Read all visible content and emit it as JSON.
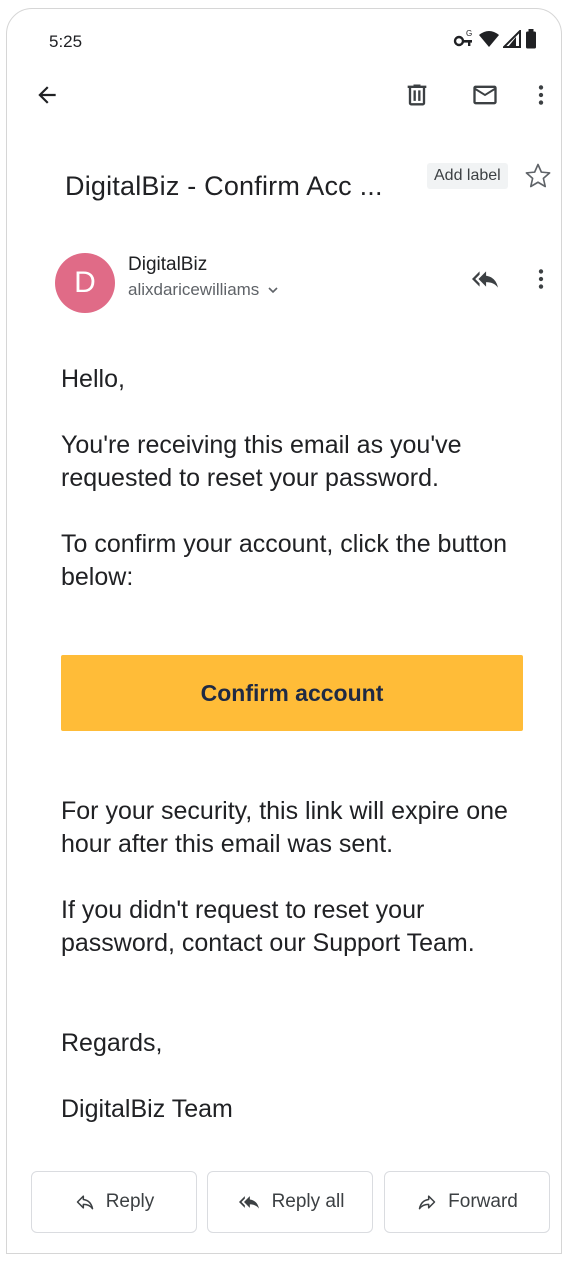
{
  "status_bar": {
    "time": "5:25",
    "icons": [
      "vpn-key-icon",
      "wifi-icon",
      "signal-icon",
      "battery-icon"
    ]
  },
  "toolbar": {
    "icons": [
      "back-arrow-icon",
      "delete-icon",
      "mark-unread-icon",
      "more-vert-icon"
    ]
  },
  "email": {
    "subject": "DigitalBiz - Confirm Acc ...",
    "label_button": "Add label",
    "sender_name": "DigitalBiz",
    "sender_address": "alixdaricewilliams",
    "avatar_initial": "D",
    "avatar_color": "#e06b87",
    "body": {
      "greeting": "Hello,",
      "p1": "You're receiving this email as you've requested to reset your password.",
      "p2": "To confirm your account, click the button below:",
      "button_label": "Confirm account",
      "p3": "For your security, this link will expire one hour after this email was sent.",
      "p4": "If you didn't request to reset your password, contact our Support Team.",
      "p5": "Regards,",
      "signature": "DigitalBiz Team"
    },
    "button_color": "#ffbc38"
  },
  "actions": {
    "reply": "Reply",
    "reply_all": "Reply all",
    "forward": "Forward"
  }
}
